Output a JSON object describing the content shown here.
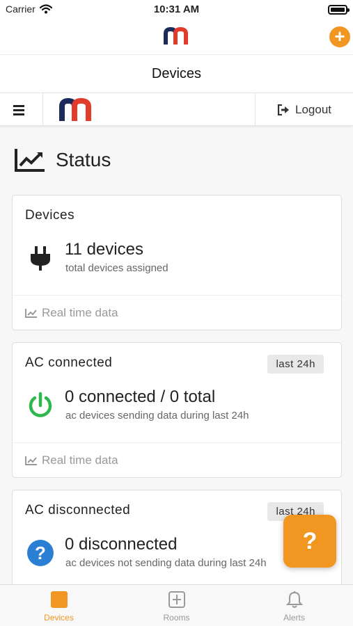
{
  "status_bar": {
    "carrier": "Carrier",
    "time": "10:31 AM"
  },
  "app_bar": {
    "logo_icon": "mn-logo",
    "add_icon": "plus-icon",
    "add_label": "+"
  },
  "title_bar": {
    "title": "Devices"
  },
  "toolbar": {
    "menu_icon": "hamburger-icon",
    "logout_label": "Logout",
    "logout_icon": "sign-out-icon"
  },
  "status_section": {
    "title": "Status",
    "icon": "line-chart-icon"
  },
  "cards": [
    {
      "title": "Devices",
      "badge": "",
      "icon": "plug-icon",
      "value": "11 devices",
      "subtitle": "total devices assigned",
      "footer": "Real time data"
    },
    {
      "title": "AC connected",
      "badge": "last 24h",
      "icon": "power-icon",
      "value": "0 connected / 0 total",
      "subtitle": "ac devices sending data during last 24h",
      "footer": "Real time data"
    },
    {
      "title": "AC disconnected",
      "badge": "last 24h",
      "icon": "question-circle-icon",
      "value": "0 disconnected",
      "subtitle": "ac devices not sending data during last 24h"
    }
  ],
  "help_button": {
    "label": "?"
  },
  "tabs": [
    {
      "label": "Devices",
      "icon": "device-square-icon",
      "active": true
    },
    {
      "label": "Rooms",
      "icon": "room-icon",
      "active": false
    },
    {
      "label": "Alerts",
      "icon": "bell-icon",
      "active": false
    }
  ],
  "colors": {
    "accent": "#f29622",
    "success": "#2db84d",
    "info": "#2a7fd4",
    "logo_blue": "#1c2b5a",
    "logo_red": "#e23b2a"
  }
}
